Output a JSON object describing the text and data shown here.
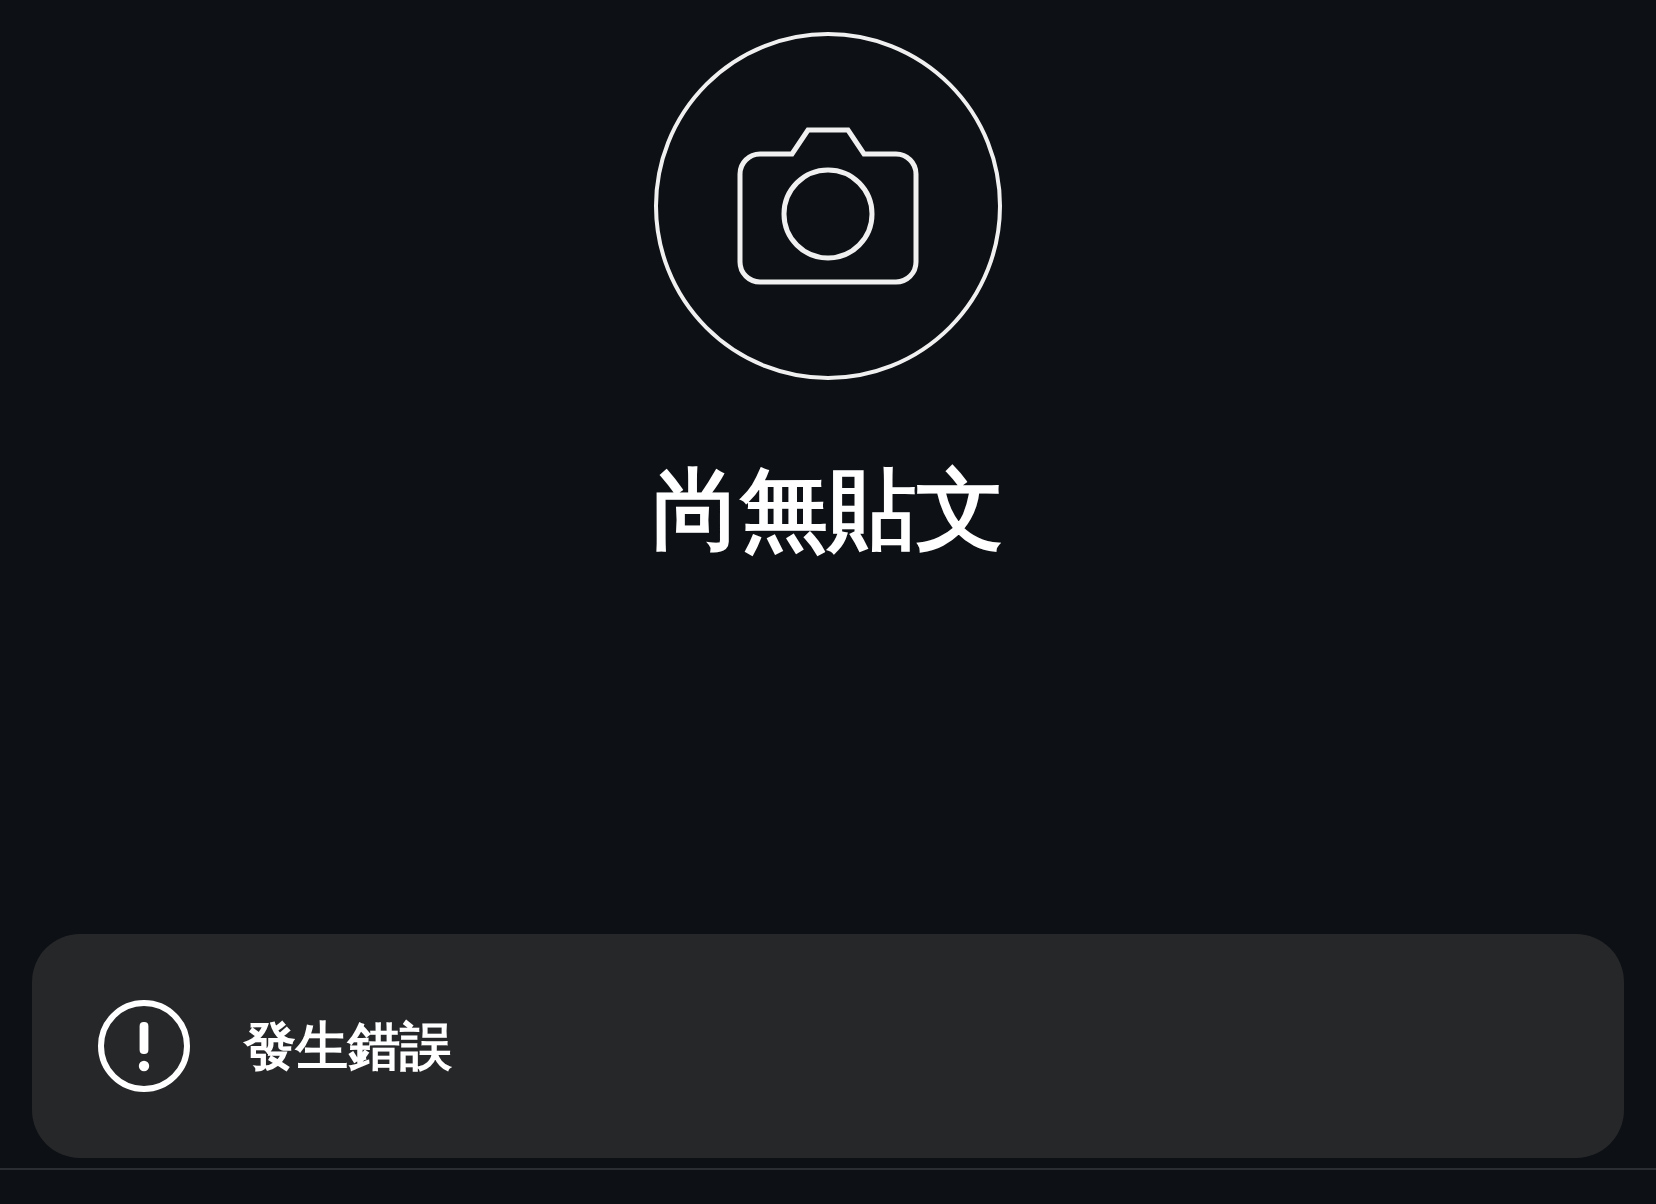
{
  "empty_state": {
    "title": "尚無貼文"
  },
  "toast": {
    "message": "發生錯誤"
  }
}
